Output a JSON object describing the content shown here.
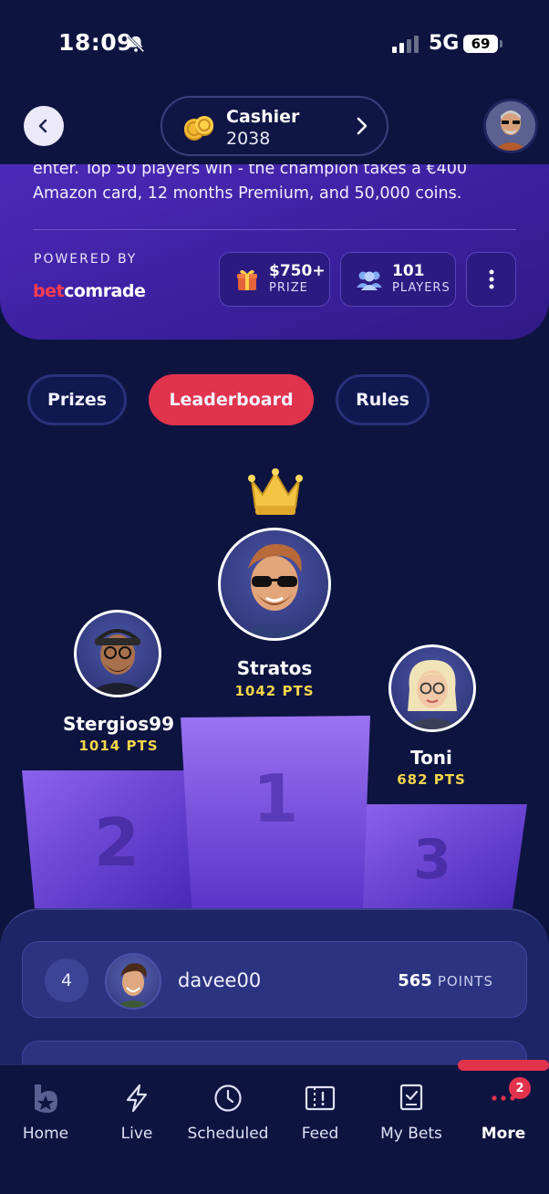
{
  "status_bar": {
    "time": "18:09",
    "network": "5G",
    "battery": "69"
  },
  "header": {
    "cashier_label": "Cashier",
    "cashier_amount": "2038"
  },
  "info": {
    "description": "enter. Top 50 players win - the champion takes a €400 Amazon card, 12 months Premium, and 50,000 coins.",
    "powered_by": "POWERED BY",
    "brand_bet": "bet",
    "brand_comrade": "comrade",
    "prize_value": "$750+",
    "prize_label": "PRIZE",
    "players_value": "101",
    "players_label": "PLAYERS"
  },
  "tabs": [
    {
      "label": "Prizes"
    },
    {
      "label": "Leaderboard"
    },
    {
      "label": "Rules"
    }
  ],
  "podium": {
    "first": {
      "name": "Stratos",
      "points": "1042 PTS",
      "rank": "1"
    },
    "second": {
      "name": "Stergios99",
      "points": "1014 PTS",
      "rank": "2"
    },
    "third": {
      "name": "Toni",
      "points": "682 PTS",
      "rank": "3"
    }
  },
  "leaderboard": [
    {
      "rank": "4",
      "username": "davee00",
      "points": "565",
      "unit": "POINTS"
    }
  ],
  "nav": {
    "home": "Home",
    "live": "Live",
    "scheduled": "Scheduled",
    "feed": "Feed",
    "mybets": "My Bets",
    "more": "More",
    "more_badge": "2"
  },
  "colors": {
    "background": "#0d1440",
    "accent": "#e2334d",
    "card": "#3a1f9c",
    "points_yellow": "#f5d54a"
  }
}
